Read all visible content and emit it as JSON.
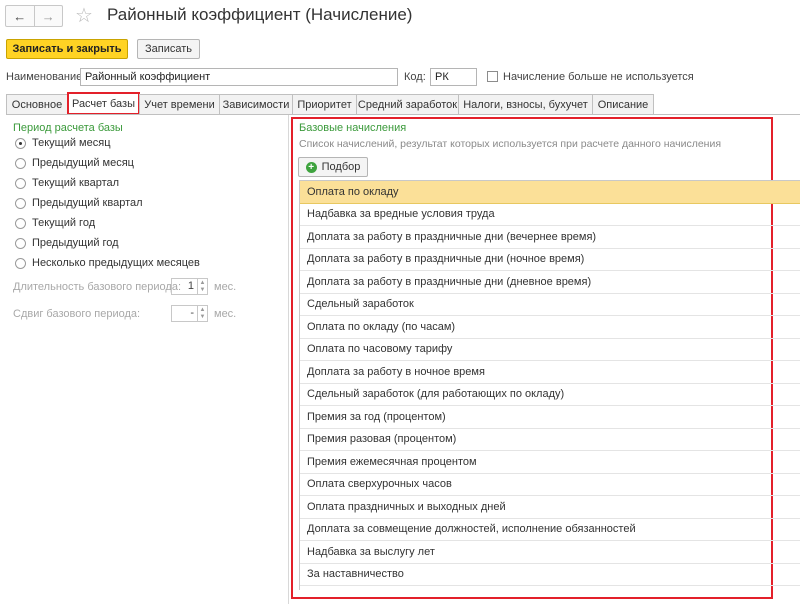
{
  "window": {
    "title": "Районный коэффициент (Начисление)",
    "back_icon": "←",
    "forward_icon": "→",
    "star_icon": "☆"
  },
  "toolbar": {
    "save_close_label": "Записать и закрыть",
    "save_label": "Записать"
  },
  "form": {
    "name_label": "Наименование:",
    "name_value": "Районный коэффициент",
    "code_label": "Код:",
    "code_value": "РК",
    "not_used_label": "Начисление больше не используется",
    "not_used_checked": false
  },
  "tabs": [
    {
      "label": "Основное",
      "active": false
    },
    {
      "label": "Расчет базы",
      "active": true
    },
    {
      "label": "Учет времени",
      "active": false
    },
    {
      "label": "Зависимости",
      "active": false
    },
    {
      "label": "Приоритет",
      "active": false
    },
    {
      "label": "Средний заработок",
      "active": false
    },
    {
      "label": "Налоги, взносы, бухучет",
      "active": false
    },
    {
      "label": "Описание",
      "active": false
    }
  ],
  "base_period": {
    "header": "Период расчета базы",
    "options": [
      {
        "label": "Текущий месяц",
        "selected": true
      },
      {
        "label": "Предыдущий месяц",
        "selected": false
      },
      {
        "label": "Текущий квартал",
        "selected": false
      },
      {
        "label": "Предыдущий квартал",
        "selected": false
      },
      {
        "label": "Текущий год",
        "selected": false
      },
      {
        "label": "Предыдущий год",
        "selected": false
      },
      {
        "label": "Несколько предыдущих месяцев",
        "selected": false
      }
    ],
    "duration_label": "Длительность базового периода:",
    "duration_value": "1",
    "duration_unit": "мес.",
    "shift_label": "Сдвиг базового периода:",
    "shift_value": "-",
    "shift_unit": "мес."
  },
  "base_accruals": {
    "header": "Базовые начисления",
    "description": "Список начислений, результат которых используется при расчете данного начисления",
    "pick_button_label": "Подбор",
    "items": [
      "Оплата по окладу",
      "Надбавка за вредные условия труда",
      "Доплата за работу в праздничные дни (вечернее время)",
      "Доплата за работу в праздничные дни (ночное время)",
      "Доплата за работу в праздничные дни (дневное время)",
      "Сдельный заработок",
      "Оплата по окладу (по часам)",
      "Оплата по часовому тарифу",
      "Доплата за работу в ночное время",
      "Сдельный заработок (для работающих по окладу)",
      "Премия за год (процентом)",
      "Премия разовая (процентом)",
      "Премия ежемесячная процентом",
      "Оплата сверхурочных часов",
      "Оплата праздничных и выходных дней",
      "Доплата за совмещение должностей, исполнение обязанностей",
      "Надбавка за выслугу лет",
      "За наставничество"
    ],
    "selected_index": 0
  },
  "colors": {
    "accent_red": "#e3202a",
    "primary_button": "#ffd324",
    "section_green": "#3b9a3b",
    "selected_row": "#fbe098"
  }
}
